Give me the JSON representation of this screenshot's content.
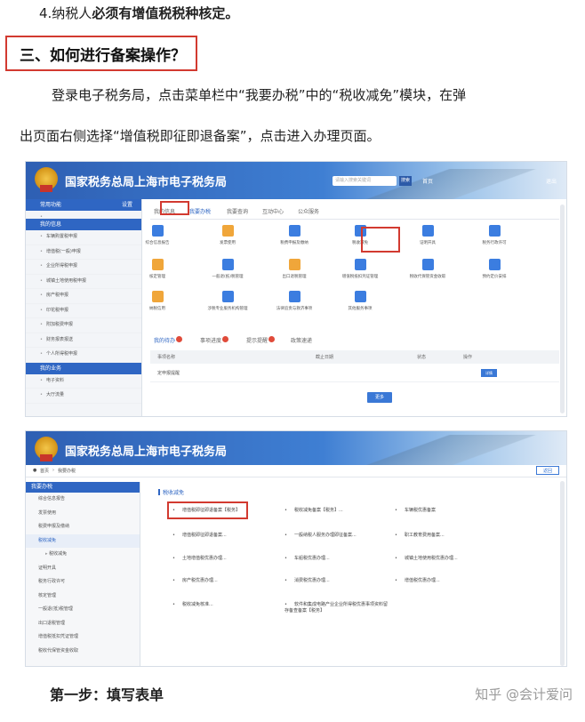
{
  "article": {
    "line1_prefix": "4.纳税人",
    "line1_bold": "必须有增值税税种核定。",
    "section_title": "三、如何进行备案操作？",
    "para_line1": "登录电子税务局，点击菜单栏中“我要办税”中的“税收减免”模块，在弹",
    "para_line2": "出页面右侧选择“增值税即征即退备案”，点击进入办理页面。",
    "step_title": "第一步：填写表单",
    "watermark": "知乎 @会计爱问"
  },
  "shot1": {
    "banner_title": "国家税务总局上海市电子税务局",
    "search_placeholder": "请输入搜索关键词",
    "search_button": "搜索",
    "header_links": [
      "首页",
      "退出"
    ],
    "sidebar_head": "常用功能",
    "sidebar_head_right": "设置",
    "sidebar_section": "我的信息",
    "sidebar_items": [
      "车辆购置税申报",
      "增值税(一般)申报",
      "企业所得税申报",
      "城镇土地使用税申报",
      "房产税申报",
      "印花税申报",
      "附加税费申报",
      "财务报表报送",
      "个人所得税申报"
    ],
    "sidebar_section2": "我的业务",
    "sidebar_items2": [
      "电子资料",
      "大厅流量"
    ],
    "tabs": [
      "我的信息",
      "我要办税",
      "我要查询",
      "互动中心",
      "公众服务"
    ],
    "icons": [
      {
        "label": "综合信息报告",
        "color": "#3b7de0"
      },
      {
        "label": "发票使用",
        "color": "#f0a63a"
      },
      {
        "label": "税费申报及缴纳",
        "color": "#3b7de0"
      },
      {
        "label": "税收减免",
        "color": "#3b7de0"
      },
      {
        "label": "证明开具",
        "color": "#3b7de0"
      },
      {
        "label": "税务行政许可",
        "color": "#3b7de0"
      },
      {
        "label": "核定管理",
        "color": "#f0a63a"
      },
      {
        "label": "一般退(抵)税管理",
        "color": "#3b7de0"
      },
      {
        "label": "出口退税管理",
        "color": "#f0a63a"
      },
      {
        "label": "增值税抵扣凭证管理",
        "color": "#3b7de0"
      },
      {
        "label": "税收代保管资金收取",
        "color": "#3b7de0"
      },
      {
        "label": "预约定价安排",
        "color": "#3b7de0"
      },
      {
        "label": "纳税信用",
        "color": "#f0a63a"
      },
      {
        "label": "涉税专业服务机构管理",
        "color": "#3b7de0"
      },
      {
        "label": "法律追责与救济事项",
        "color": "#3b7de0"
      },
      {
        "label": "其他服务事项",
        "color": "#3b7de0"
      }
    ],
    "bottom_tabs": [
      "我的待办",
      "事项进度",
      "提示提醒",
      "政策速递"
    ],
    "table_headers": [
      "事项名称",
      "截止日期",
      "状态",
      "操作"
    ],
    "table_row": "financial_report",
    "row_name": "定申报提醒",
    "row_button": "详情",
    "more_button": "更多"
  },
  "shot2": {
    "banner_title": "国家税务总局上海市电子税务局",
    "crumb_home": "首页",
    "crumb_current": "我要办税",
    "back_button": "返回",
    "side_head": "我要办税",
    "side_items": [
      "综合信息报告",
      "发票使用",
      "税费申报及缴纳",
      "税收减免",
      "税收减免",
      "证明开具",
      "税务行政许可",
      "核定管理",
      "一般退(抵)税管理",
      "出口退税管理",
      "增值税抵扣凭证管理",
      "税收代保管资金收取"
    ],
    "section_label": "税收减免",
    "links": [
      "增值税即征即退备案【税务】",
      "税收减免备案【税务】...",
      "车辆税优惠备案",
      "增值税即征即退备案...",
      "一般纳税人服务办理即征备案...",
      "职工教育费用备案...",
      "土地增值税优惠办理...",
      "车船税优惠办理...",
      "城镇土地使用税优惠办理...",
      "房产税优惠办理...",
      "消费税优惠办理...",
      "增值税优惠办理...",
      "税收减免核准...",
      "软件和集成电路产业企业所得税优惠事项资料留存备查备案【税务】",
      ""
    ]
  }
}
